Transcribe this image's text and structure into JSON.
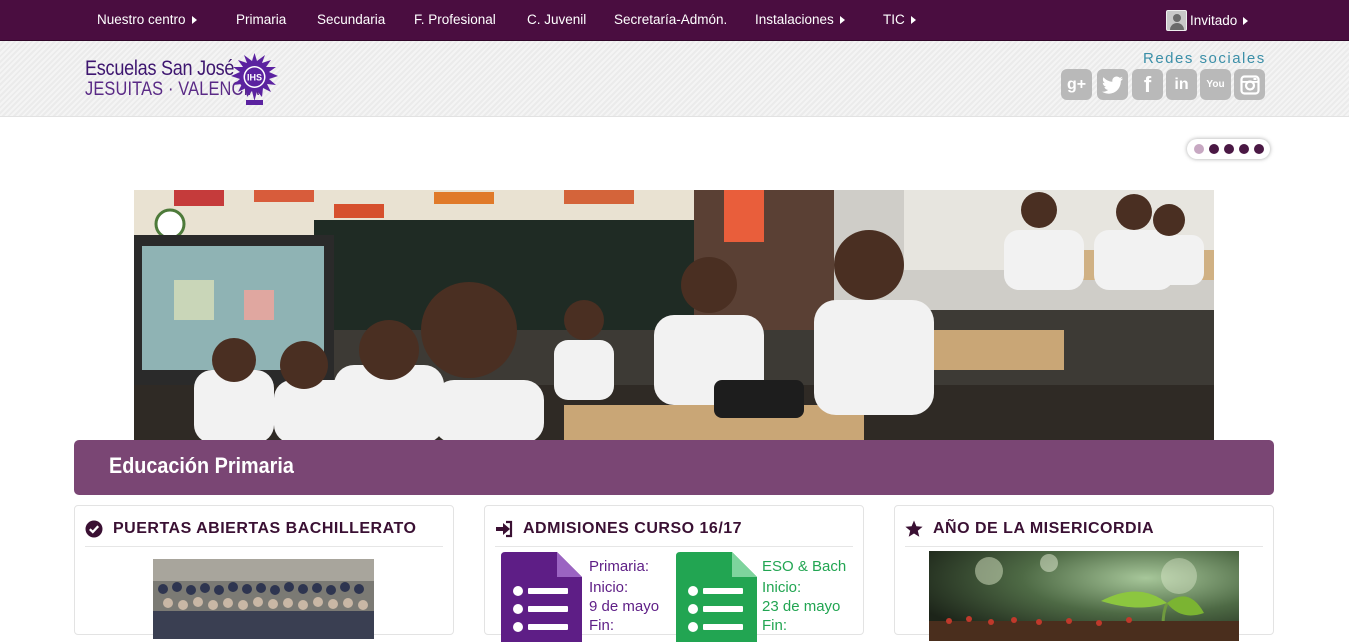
{
  "nav": {
    "items": [
      {
        "label": "Nuestro centro",
        "has_caret": true
      },
      {
        "label": "Primaria",
        "has_caret": false
      },
      {
        "label": "Secundaria",
        "has_caret": false
      },
      {
        "label": "F. Profesional",
        "has_caret": false
      },
      {
        "label": "C. Juvenil",
        "has_caret": false
      },
      {
        "label": "Secretaría-Admón.",
        "has_caret": false
      },
      {
        "label": "Instalaciones",
        "has_caret": true
      },
      {
        "label": "TIC",
        "has_caret": true
      }
    ],
    "user_label": "Invitado"
  },
  "header": {
    "logo_line1": "Escuelas San José",
    "logo_line2": "JESUITAS · VALENCIA",
    "logo_emblem_text": "IHS",
    "redes_label": "Redes sociales",
    "social_icons": [
      {
        "name": "google-plus-icon",
        "glyph": "g+"
      },
      {
        "name": "twitter-icon",
        "glyph": "t"
      },
      {
        "name": "facebook-icon",
        "glyph": "f"
      },
      {
        "name": "linkedin-icon",
        "glyph": "in"
      },
      {
        "name": "youtube-icon",
        "glyph": "You"
      },
      {
        "name": "instagram-icon",
        "glyph": "ig"
      }
    ]
  },
  "slider": {
    "dot_count": 5,
    "active_index": 0
  },
  "section": {
    "title": "Educación Primaria"
  },
  "cards": [
    {
      "title": "PUERTAS ABIERTAS BACHILLERATO",
      "icon": "check-circle-icon"
    },
    {
      "title": "ADMISIONES CURSO 16/17",
      "icon": "sign-in-icon",
      "docs": [
        {
          "label": "Primaria:",
          "line1": "Inicio:",
          "line2": "9 de mayo",
          "line3": "Fin:",
          "color": "#5e1e86"
        },
        {
          "label": "ESO & Bach",
          "line1": "Inicio:",
          "line2": "23 de mayo",
          "line3": "Fin:",
          "color": "#22a552"
        }
      ]
    },
    {
      "title": "AÑO DE LA MISERICORDIA",
      "icon": "star-icon"
    }
  ],
  "colors": {
    "nav_bg": "#4a0d40",
    "title_bar": "#7a4674",
    "accent_purple": "#5e1e86",
    "accent_green": "#22a552",
    "redes_blue": "#3b8fa8"
  }
}
